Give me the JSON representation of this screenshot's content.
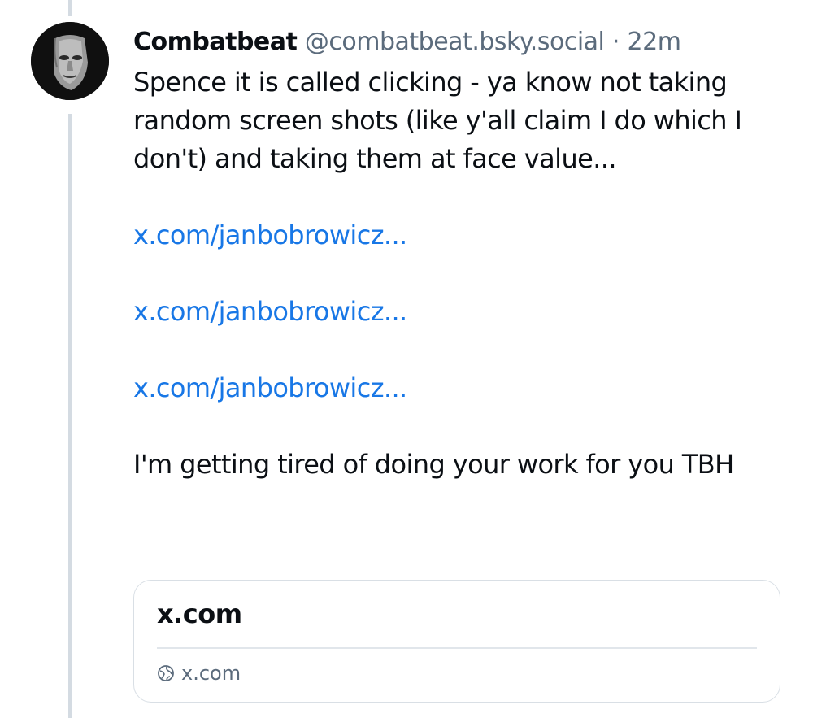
{
  "post": {
    "author_name": "Combatbeat",
    "author_handle": "@combatbeat.bsky.social",
    "separator": "·",
    "time_ago": "22m",
    "text_para1": "Spence it is called clicking - ya know not taking random screen shots (like y'all claim I do which I don't) and taking them at face value...",
    "links": [
      "x.com/janbobrowicz...",
      "x.com/janbobrowicz...",
      "x.com/janbobrowicz..."
    ],
    "text_para2": "I'm getting tired of doing your work for you TBH"
  },
  "embed": {
    "title": "x.com",
    "domain": "x.com",
    "domain_icon": "globe-icon"
  },
  "colors": {
    "link": "#1877e6",
    "muted": "#5b6b7c",
    "thread_line": "#d4dbe2"
  }
}
